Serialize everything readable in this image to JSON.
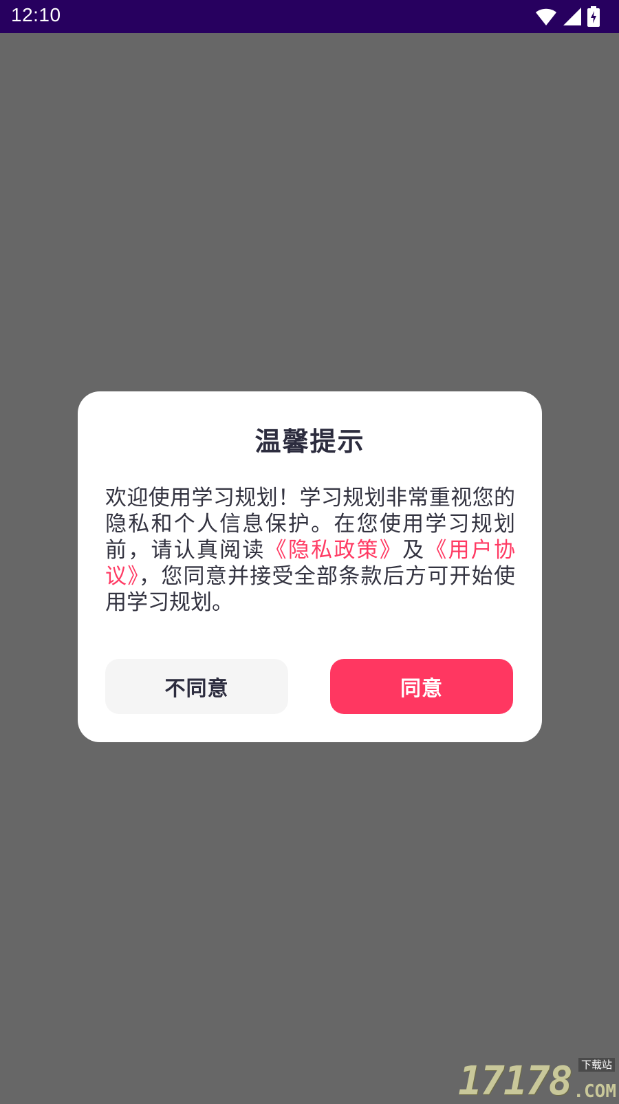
{
  "status_bar": {
    "time": "12:10",
    "icons": [
      "wifi-icon",
      "cell-signal-icon",
      "battery-charging-icon"
    ]
  },
  "dialog": {
    "title": "温馨提示",
    "body": {
      "text_1": "欢迎使用学习规划！学习规划非常重视您的隐私和个人信息保护。在您使用学习规划前，请认真阅读",
      "privacy_link": "《隐私政策》",
      "text_2": "及",
      "user_agreement_link": "《用户协议》",
      "text_3": "，您同意并接受全部条款后方可开始使用学习规划。"
    },
    "decline_label": "不同意",
    "agree_label": "同意"
  },
  "watermark": {
    "digits": "17178",
    "suffix": ".COM",
    "tag": "下载站"
  },
  "colors": {
    "status_bar": "#27005f",
    "backdrop": "#676767",
    "accent": "#ff3761",
    "link": "#ff3a63",
    "title_text": "#2c2c3e"
  }
}
